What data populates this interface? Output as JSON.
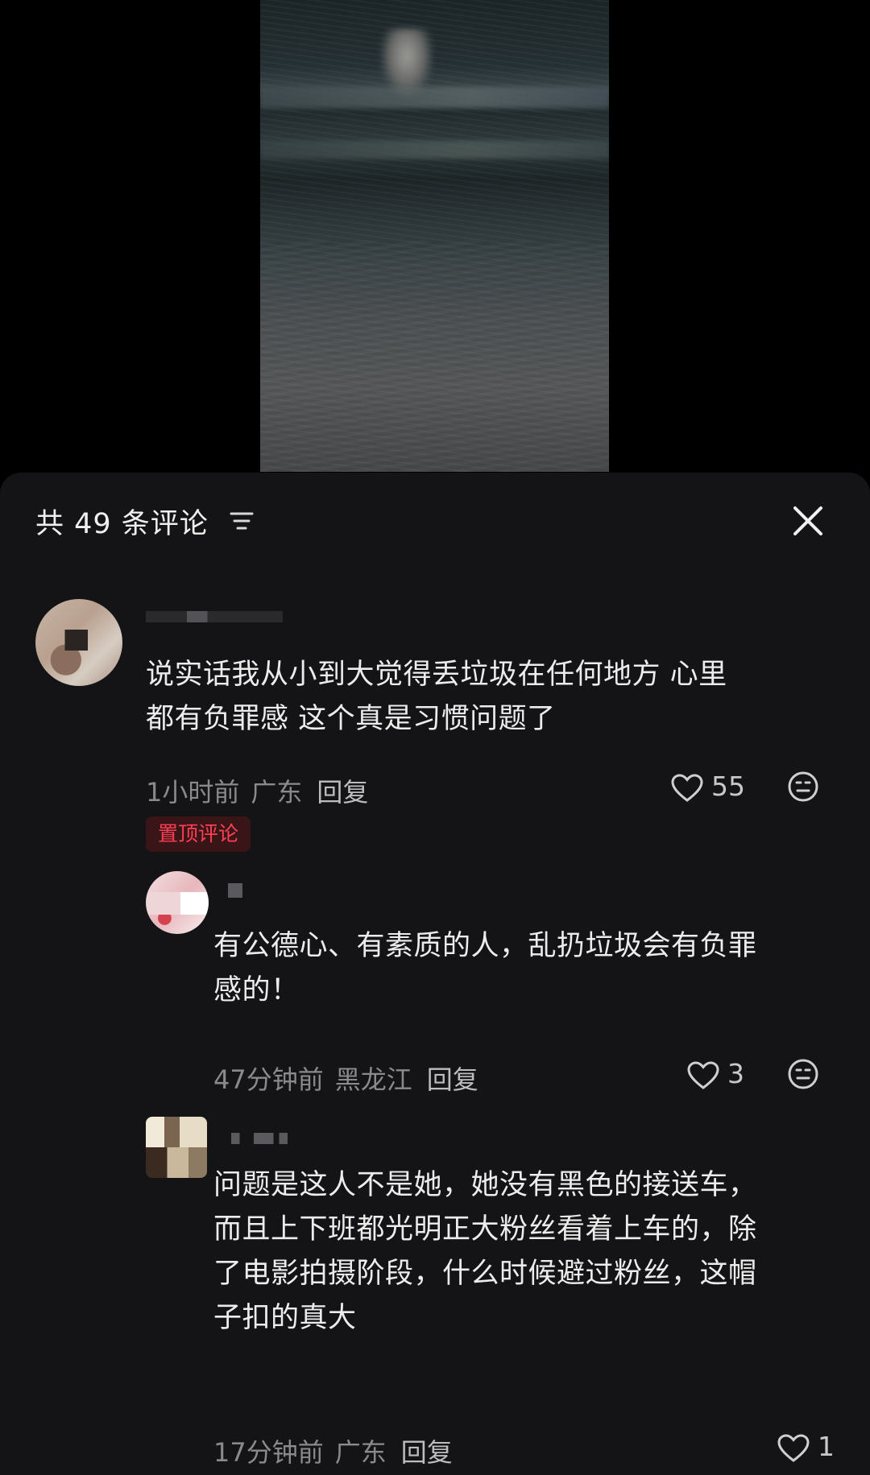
{
  "header": {
    "title": "共 49 条评论"
  },
  "comments": [
    {
      "text_line1": "说实话我从小到大觉得丢垃圾在任何地方 心里",
      "text_line2": "都有负罪感 这个真是习惯问题了",
      "time": "1小时前",
      "location": "广东",
      "reply_label": "回复",
      "likes": "55",
      "badge": "置顶评论"
    },
    {
      "text_line1": "有公德心、有素质的人，乱扔垃圾会有负罪",
      "text_line2": "感的！",
      "time": "47分钟前",
      "location": "黑龙江",
      "reply_label": "回复",
      "likes": "3"
    },
    {
      "text_line1": "问题是这人不是她，她没有黑色的接送车，",
      "text_line2": "而且上下班都光明正大粉丝看着上车的，除",
      "text_line3": "了电影拍摄阶段，什么时候避过粉丝，这帽",
      "text_line4": "子扣的真大",
      "time": "17分钟前",
      "location": "广东",
      "reply_label": "回复",
      "likes": "1"
    }
  ],
  "colors": {
    "panel_bg": "#141416",
    "badge_text": "#ff3f53",
    "badge_bg": "#3a1518"
  },
  "icons": [
    "filter-icon",
    "close-icon",
    "heart-icon",
    "emoji-icon"
  ]
}
